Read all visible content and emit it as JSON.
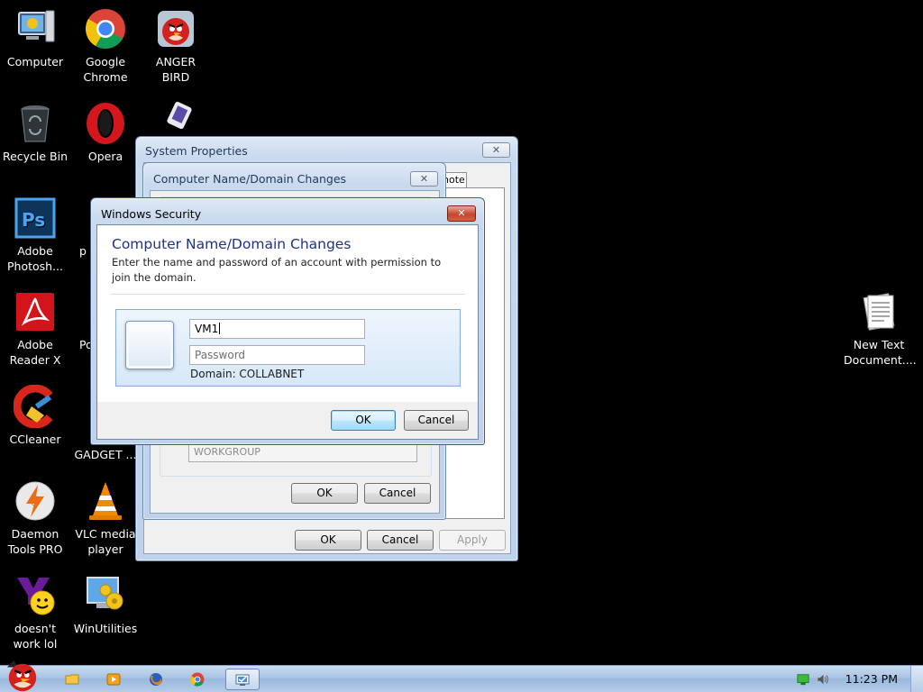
{
  "desktop": {
    "icons": [
      {
        "name": "computer-icon",
        "label": "Computer"
      },
      {
        "name": "google-chrome-icon",
        "label": "Google\nChrome"
      },
      {
        "name": "anger-bird-icon",
        "label": "ANGER\nBIRD"
      },
      {
        "name": "recycle-bin-icon",
        "label": "Recycle Bin"
      },
      {
        "name": "opera-icon",
        "label": "Opera"
      },
      {
        "name": "adobe-photoshop-icon",
        "label": "Adobe\nPhotosh..."
      },
      {
        "name": "adobe-reader-icon",
        "label": "Adobe\nReader X"
      },
      {
        "name": "ccleaner-icon",
        "label": "CCleaner"
      },
      {
        "name": "daemon-tools-icon",
        "label": "Daemon\nTools PRO"
      },
      {
        "name": "vlc-icon",
        "label": "VLC media\nplayer"
      },
      {
        "name": "yahoo-messenger-icon",
        "label": "doesn't\nwork lol"
      },
      {
        "name": "winutilities-icon",
        "label": "WinUtilities"
      },
      {
        "name": "new-text-document-icon",
        "label": "New Text\nDocument...."
      },
      {
        "name": "partial-icon-p",
        "label": "p"
      },
      {
        "name": "partial-icon-po",
        "label": "Po"
      },
      {
        "name": "partial-icon-gadget",
        "label": "G\nGADGET ..."
      }
    ]
  },
  "system_properties": {
    "title": "System Properties",
    "close": "✕",
    "tab_fragment": "note",
    "ok": "OK",
    "cancel": "Cancel",
    "apply": "Apply"
  },
  "name_changes": {
    "title": "Computer Name/Domain Changes",
    "close": "✕",
    "workgroup_value": "WORKGROUP",
    "ok": "OK",
    "cancel": "Cancel"
  },
  "windows_security": {
    "title": "Windows Security",
    "close": "✕",
    "heading": "Computer Name/Domain Changes",
    "description": "Enter the name and password of an account with permission to join the domain.",
    "username_value": "VM1",
    "password_placeholder": "Password",
    "domain_text": "Domain: COLLABNET",
    "ok": "OK",
    "cancel": "Cancel"
  },
  "taskbar": {
    "clock": "11:23 PM",
    "items": [
      "start-orb",
      "explorer",
      "media-player",
      "firefox",
      "chrome",
      "system-properties"
    ]
  },
  "colors": {
    "desktop": "#000000",
    "taskbar": "#a9c3e3",
    "heading": "#1e3287",
    "close_red": "#c8442c"
  }
}
